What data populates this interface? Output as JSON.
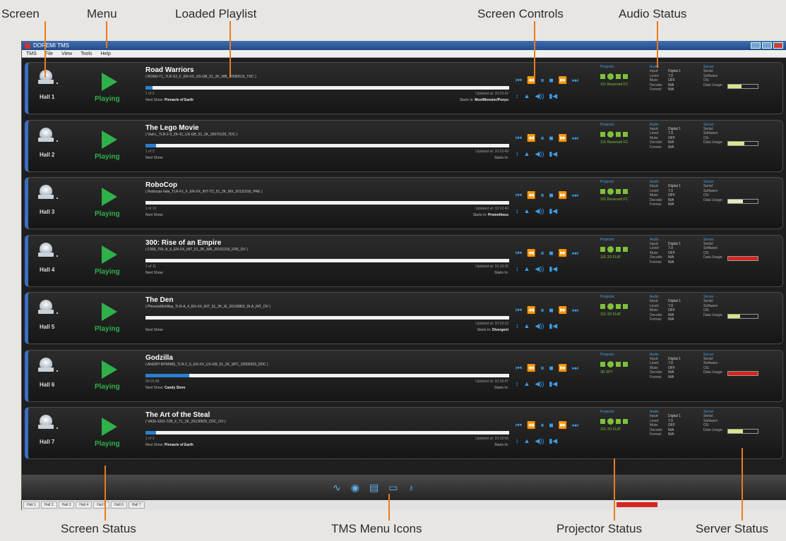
{
  "callouts": {
    "screen": "Screen",
    "menu": "Menu",
    "loaded_playlist": "Loaded Playlist",
    "screen_controls": "Screen Controls",
    "audio_status": "Audio Status",
    "screen_status": "Screen Status",
    "tms_menu_icons": "TMS Menu Icons",
    "projector_status": "Projector Status",
    "server_status": "Server Status"
  },
  "window": {
    "title": "DOREMI TMS"
  },
  "menu": {
    "items": [
      "TMS",
      "File",
      "View",
      "Tools",
      "Help"
    ]
  },
  "halls": [
    {
      "name": "Hall 1",
      "status": "Playing",
      "title": "Road Warriors",
      "cpl": "( ROAD-T1_TLR-S2_F_EN-XX_US-GB_51_2K_WB_20080515_TDC )",
      "progress": 0.02,
      "row1": "1 of 3",
      "row1r": "Updated at: 10:23:42",
      "next_label": "Next Show:",
      "next_show": "Pinnacle of Earth",
      "starts_label": "Starts In:",
      "starts_in": "Mon/Monster/Ponyo",
      "lamp": "101",
      "proj_text": "Reserved FC",
      "disk_pct": 0.45,
      "disk_color": "#d6e88a"
    },
    {
      "name": "Hall 2",
      "status": "Playing",
      "title": "The Lego Movie",
      "cpl": "( Vad-L_TLR-2-3_2K-41_US-GB_51_2K_20070129_TDC )",
      "progress": 0.03,
      "row1": "1 of 3",
      "row1r": "Updated at: 10:23:49",
      "next_label": "Next Show:",
      "next_show": "",
      "starts_label": "Starts In:",
      "starts_in": "",
      "lamp": "101",
      "proj_text": "Reserved FC",
      "disk_pct": 0.55,
      "disk_color": "#d6e88a"
    },
    {
      "name": "Hall 3",
      "status": "Playing",
      "title": "RoboCop",
      "cpl": "( Robocop-Vale_TLR-F1_F_EN-XX_INT-TD_51_2K_MX_20131016_PRE )",
      "progress": 0.0,
      "row1": "1 of 10",
      "row1r": "Updated at: 10:19:40",
      "next_label": "Next Show:",
      "next_show": "",
      "starts_label": "Starts In:",
      "starts_in": "Prometheus",
      "lamp": "101",
      "proj_text": "Reserved FC",
      "disk_pct": 0.5,
      "disk_color": "#e9e9c0"
    },
    {
      "name": "Hall 4",
      "status": "Playing",
      "title": "300: Rise of an Empire",
      "cpl": "( F300_TRL-8_S_EN-XX_INT_51_2K_WR_20131216_FR5_OV )",
      "progress": 0.0,
      "row1": "1 of 11",
      "row1r": "Updated at: 10:18:36",
      "next_label": "Next Show:",
      "next_show": "",
      "starts_label": "Starts In:",
      "starts_in": "",
      "lamp": "101",
      "proj_text": "2D FLAT",
      "disk_pct": 1.0,
      "disk_color": "#d5261f"
    },
    {
      "name": "Hall 5",
      "status": "Playing",
      "title": "The Den",
      "cpl": "( PhoenixMotWas_TLR-A_4_EN-XX_INT_51_2K_IE_20130802_DLA_INT_OV )",
      "progress": 0.0,
      "row1": "",
      "row1r": "Updated at: 10:19:12",
      "next_label": "Next Show:",
      "next_show": "",
      "starts_label": "Starts In:",
      "starts_in": "Divergent",
      "lamp": "101",
      "proj_text": "2D FLAT",
      "disk_pct": 0.4,
      "disk_color": "#d6e88a"
    },
    {
      "name": "Hall 6",
      "status": "Playing",
      "title": "Godzilla",
      "cpl": "( ANGRY-MYMIMS_TLR-2_S_EN-XX_US-GB_51_2K_SPC_20090203_DDC )",
      "progress": 0.12,
      "row1": "00:01:58",
      "row1r": "Updated at: 10:18:47",
      "next_label": "Next Show:",
      "next_show": "Candy Store",
      "starts_label": "Starts In:",
      "starts_in": "",
      "lamp": "",
      "proj_text": "3D XPT",
      "disk_pct": 1.0,
      "disk_color": "#d5261f"
    },
    {
      "name": "Hall 7",
      "status": "Playing",
      "title": "The Art of the Steal",
      "cpl": "( VA20-1091-T2B_F_T1_2K_20130629_CDC_OV )",
      "progress": 0.03,
      "row1": "1 of 3",
      "row1r": "Updated at: 10:18:58",
      "next_label": "Next Show:",
      "next_show": "Pinnacle of Earth",
      "starts_label": "Starts In:",
      "starts_in": "",
      "lamp": "101",
      "proj_text": "2D FLAT",
      "disk_pct": 0.5,
      "disk_color": "#d6e88a"
    }
  ],
  "labels": {
    "projector": "Projector",
    "audio": "Audio",
    "server": "Server",
    "input": "Input:",
    "level": "Level:",
    "mute": "Mute:",
    "decode": "Decode:",
    "format": "Format:",
    "serial": "Serial:",
    "software": "Software:",
    "os": "OS:",
    "data_usage": "Data Usage:"
  },
  "audio_values": {
    "input": "Digital 1",
    "level": "7.0",
    "mute": "OFF",
    "decode": "N/A",
    "format": "N/A"
  },
  "taskbar": {
    "tabs": [
      "Hall 1",
      "Hall 2",
      "Hall 3",
      "Hall 4",
      "Hall 5",
      "Hall 6",
      "Hall 7"
    ]
  },
  "colors": {
    "accent": "#3f9ee8",
    "playing": "#2fb14a",
    "callout_line": "#e87c1e"
  }
}
